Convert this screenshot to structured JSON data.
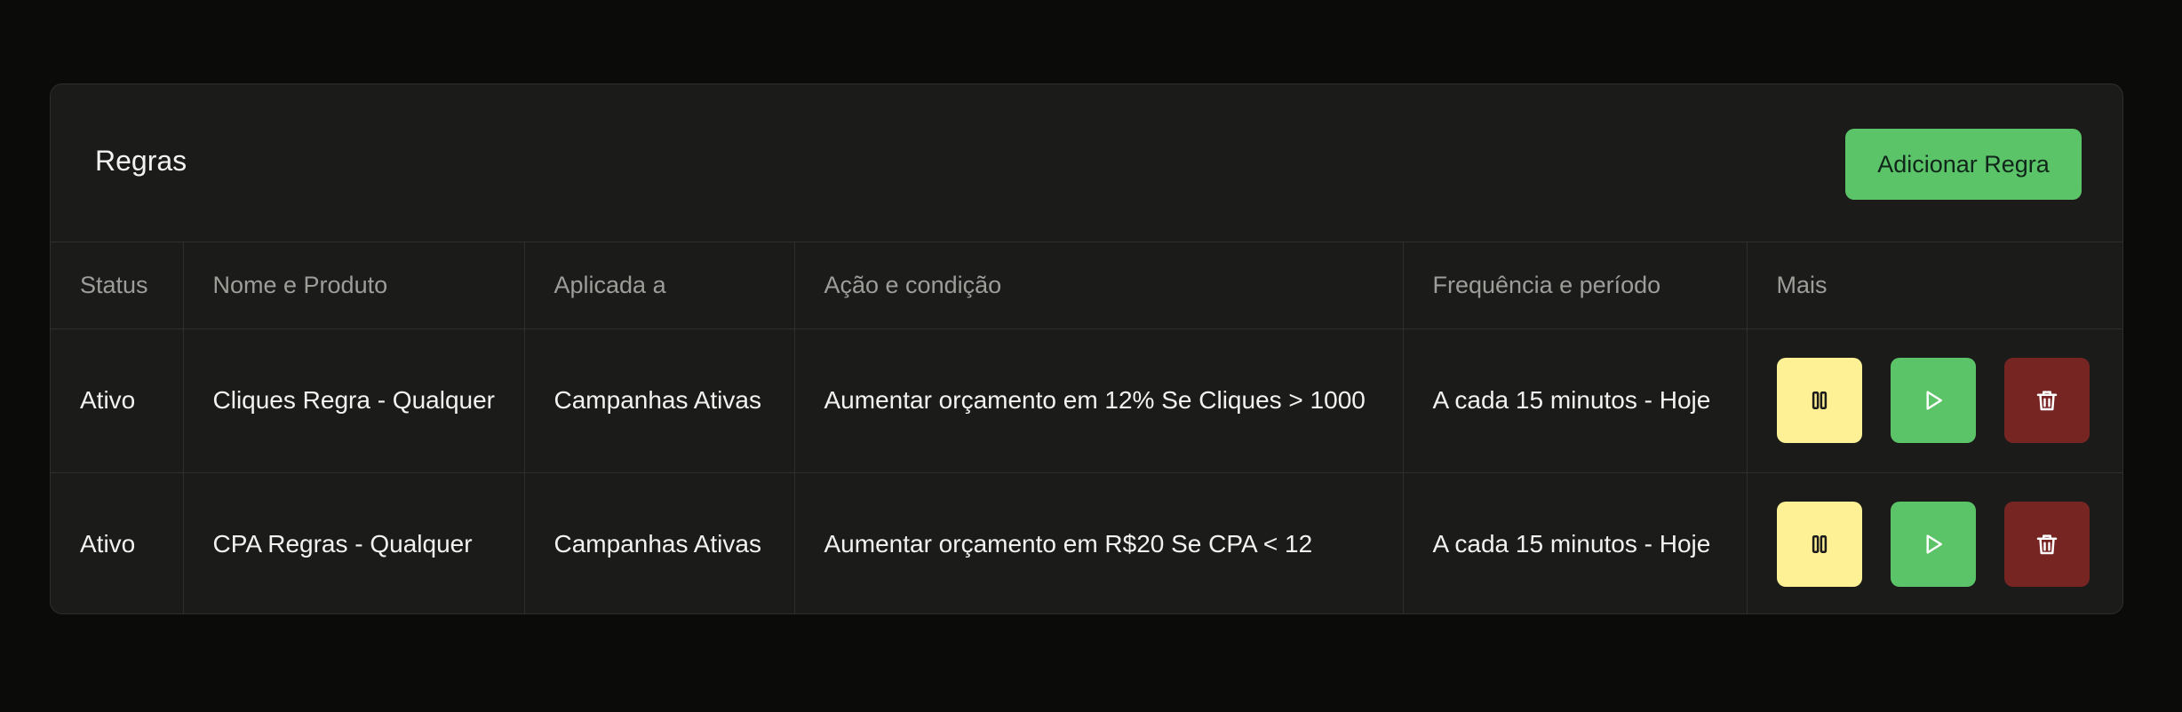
{
  "panel": {
    "title": "Regras",
    "add_button_label": "Adicionar Regra"
  },
  "table": {
    "headers": [
      "Status",
      "Nome e Produto",
      "Aplicada a",
      "Ação e condição",
      "Frequência e período",
      "Mais"
    ],
    "rows": [
      {
        "status": "Ativo",
        "name": "Cliques Regra - Qualquer",
        "applied_to": "Campanhas Ativas",
        "action": "Aumentar orçamento em 12% Se Cliques > 1000",
        "frequency": "A cada 15 minutos - Hoje"
      },
      {
        "status": "Ativo",
        "name": "CPA Regras - Qualquer",
        "applied_to": "Campanhas Ativas",
        "action": "Aumentar orçamento em R$20 Se CPA < 12",
        "frequency": "A cada 15 minutos - Hoje"
      }
    ]
  },
  "icons": {
    "pause": "pause-icon",
    "play": "play-icon",
    "delete": "trash-icon"
  },
  "colors": {
    "background": "#0b0b0a",
    "panel": "#1b1b1a",
    "accent_green": "#5cc468",
    "pause_yellow": "#fdf095",
    "delete_red": "#772522"
  }
}
